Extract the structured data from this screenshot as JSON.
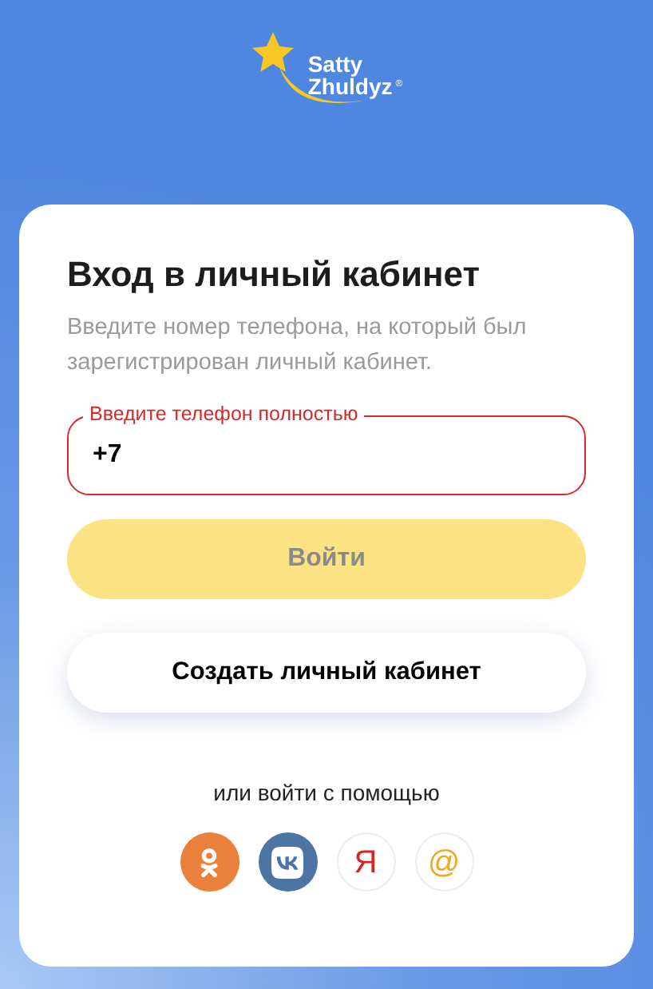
{
  "logo": {
    "line_1": "Satty",
    "line_2": "Zhuldyz",
    "mark": "®"
  },
  "title": "Вход в личный кабинет",
  "subtitle": "Введите номер телефона, на который был зарегистрирован личный кабинет.",
  "phone_field": {
    "label": "Введите телефон полностью",
    "value": "+7",
    "error": true
  },
  "login_button": {
    "label": "Войти",
    "disabled": true
  },
  "create_button": {
    "label": "Создать личный кабинет"
  },
  "alt_login": "или войти с помощью",
  "social": [
    {
      "kind": "ok",
      "color": "#e9813a"
    },
    {
      "kind": "vk",
      "color": "#4c75a3"
    },
    {
      "kind": "glyph",
      "text": "Я",
      "color": "#e0201b"
    },
    {
      "kind": "glyph",
      "text": "@",
      "color": "#f2a922"
    }
  ]
}
